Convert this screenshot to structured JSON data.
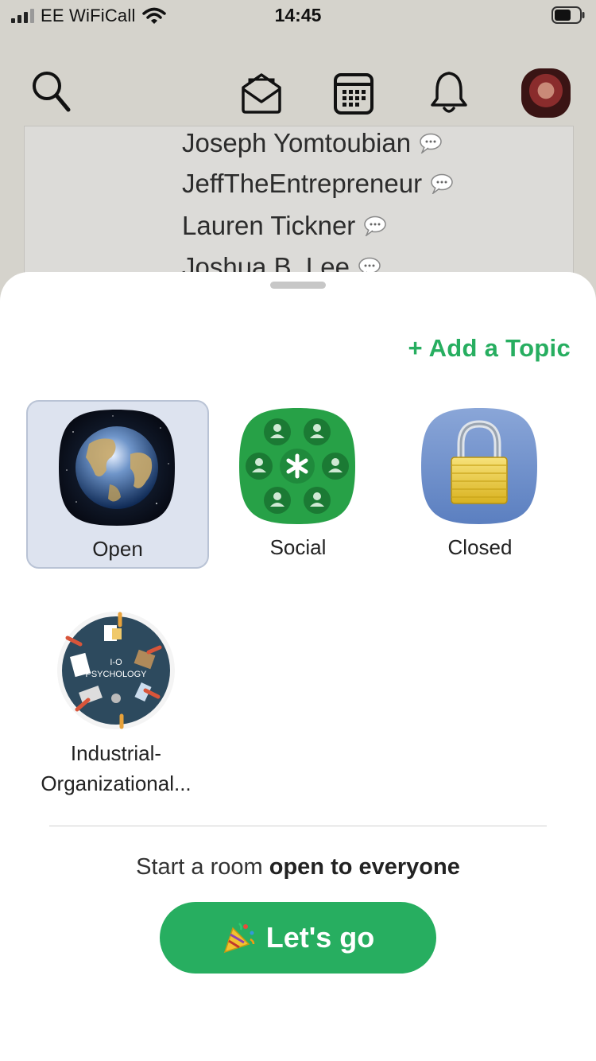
{
  "status_bar": {
    "carrier": "EE WiFiCall",
    "time": "14:45"
  },
  "topbar": {
    "icons": [
      "search-icon",
      "envelope-icon",
      "calendar-icon",
      "bell-icon"
    ],
    "avatar": "profile-avatar"
  },
  "room_card": {
    "speakers": [
      "Joseph Yomtoubian",
      "JeffTheEntrepreneur",
      "Lauren Tickner",
      "Joshua B. Lee"
    ]
  },
  "sheet": {
    "add_topic": "+ Add a Topic",
    "room_types": [
      {
        "label": "Open",
        "icon": "globe-icon",
        "selected": true
      },
      {
        "label": "Social",
        "icon": "social-group-icon",
        "selected": false
      },
      {
        "label": "Closed",
        "icon": "padlock-icon",
        "selected": false
      }
    ],
    "club": {
      "label_line1": "Industrial-",
      "label_line2": "Organizational...",
      "image_text_1": "I-O",
      "image_text_2": "PSYCHOLOGY"
    },
    "hint_prefix": "Start a room ",
    "hint_bold": "open to everyone",
    "go_label": "Let's go"
  },
  "colors": {
    "accent": "#27ae60",
    "selected_tile": "#dde3ef"
  }
}
